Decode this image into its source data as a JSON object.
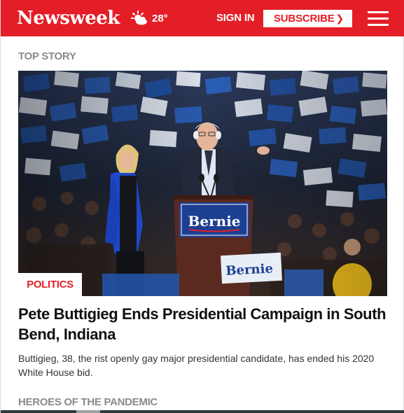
{
  "header": {
    "logo": "Newsweek",
    "weather_icon": "sun-cloud-icon",
    "temperature": "28°",
    "sign_in_label": "SIGN IN",
    "subscribe_label": "SUBSCRIBE",
    "subscribe_icon": "chevron-right-icon",
    "menu_icon": "hamburger-menu-icon",
    "brand_color": "#e41e26"
  },
  "top_story": {
    "section_label": "TOP STORY",
    "category_badge": "POLITICS",
    "headline": "Pete Buttigieg Ends Presidential Campaign in South Bend, Indiana",
    "dek": "Buttigieg, 38, the rist openly gay major presidential candidate, has ended his 2020 White House bid.",
    "image_podium_sign": "Bernie",
    "image_crowd_sign": "Bernie"
  },
  "next_section": {
    "section_label": "HEROES OF THE PANDEMIC"
  }
}
